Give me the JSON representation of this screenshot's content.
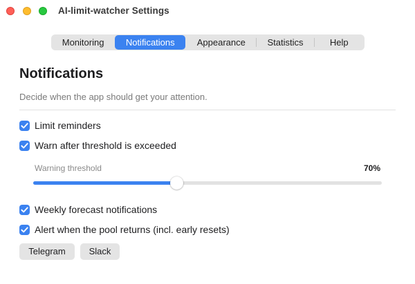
{
  "window": {
    "title": "AI-limit-watcher Settings"
  },
  "tabs": [
    {
      "label": "Monitoring",
      "selected": false
    },
    {
      "label": "Notifications",
      "selected": true
    },
    {
      "label": "Appearance",
      "selected": false
    },
    {
      "label": "Statistics",
      "selected": false
    },
    {
      "label": "Help",
      "selected": false
    }
  ],
  "section": {
    "title": "Notifications",
    "subtitle": "Decide when the app should get your attention."
  },
  "options": {
    "limit_reminders": {
      "label": "Limit reminders",
      "checked": true
    },
    "warn_threshold": {
      "label": "Warn after threshold is exceeded",
      "checked": true
    },
    "weekly_forecast": {
      "label": "Weekly forecast notifications",
      "checked": true
    },
    "pool_returns": {
      "label": "Alert when the pool returns (incl. early resets)",
      "checked": true
    }
  },
  "threshold": {
    "label": "Warning threshold",
    "value_text": "70%",
    "level": 0.41
  },
  "buttons": {
    "telegram": "Telegram",
    "slack": "Slack"
  },
  "colors": {
    "accent": "#3b82f0",
    "traffic_close": "#ff5f57",
    "traffic_minimize": "#febc2e",
    "traffic_zoom": "#28c840"
  },
  "icons": {
    "checkbox": "checkmark-icon",
    "window_controls": [
      "close-icon",
      "minimize-icon",
      "zoom-icon"
    ]
  }
}
